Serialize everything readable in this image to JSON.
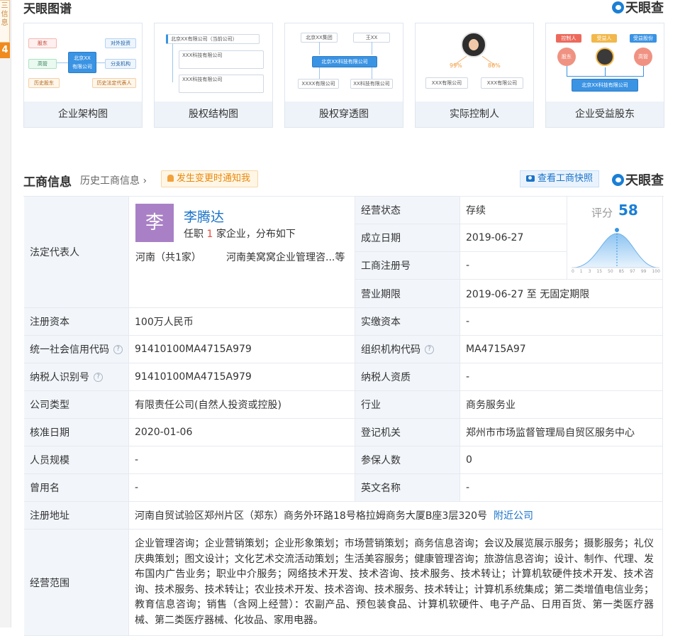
{
  "rail": {
    "tab_text": "三\n信\n息",
    "badge": "4"
  },
  "graph": {
    "title": "天眼图谱",
    "brand": "天眼查",
    "cards": [
      {
        "label": "企业架构图",
        "nodes": {
          "shareholder": "股东",
          "executive": "高管",
          "history_shareholder": "历史股东",
          "investment": "对外投资",
          "branch": "分支机构",
          "history_legal": "历史法定代表人",
          "center": "北京XX\n有限公司"
        }
      },
      {
        "label": "股权结构图",
        "nodes": {
          "top": "北京XX有限公司（当前公司）",
          "a": "XXX科技有限公司",
          "b": "XXX科技有限公司"
        }
      },
      {
        "label": "股权穿透图",
        "nodes": {
          "a": "北京XX集团",
          "b": "王XX",
          "center": "北京XX科技有限公司",
          "c": "XXXX有限公司",
          "d": "XX科技有限公司"
        }
      },
      {
        "label": "实际控制人",
        "nodes": {
          "p1": "99%",
          "p2": "86%",
          "a": "XXX有限公司",
          "b": "XXX有限公司"
        }
      },
      {
        "label": "企业受益股东",
        "nodes": {
          "t1": "控制人",
          "t2": "受益人",
          "t3": "受益股份",
          "c1": "股东",
          "c3": "高管",
          "main": "北京XX科技有限公司"
        }
      }
    ]
  },
  "biz": {
    "title": "工商信息",
    "history_link": "历史工商信息",
    "notify_label": "发生变更时通知我",
    "snapshot_label": "查看工商快照",
    "brand": "天眼查",
    "legal": {
      "key": "法定代表人",
      "avatar_char": "李",
      "name": "李腾达",
      "tenure_prefix": "任职",
      "tenure_count": "1",
      "tenure_suffix": "家企业，分布如下",
      "region": "河南（共1家）",
      "company": "河南美窝窝企业管理咨...等"
    },
    "score": {
      "label": "评分",
      "value": "58",
      "ticks": [
        "0",
        "1",
        "3",
        "15",
        "50",
        "85",
        "97",
        "99",
        "100"
      ]
    },
    "top_rows": [
      {
        "key": "经营状态",
        "value": "存续"
      },
      {
        "key": "成立日期",
        "value": "2019-06-27"
      },
      {
        "key": "工商注册号",
        "value": "-"
      },
      {
        "key": "营业期限",
        "value": "2019-06-27  至 无固定期限"
      }
    ],
    "rows": [
      {
        "k1": "注册资本",
        "v1": "100万人民币",
        "k2": "实缴资本",
        "v2": "-"
      },
      {
        "k1": "统一社会信用代码",
        "v1": "91410100MA4715A979",
        "k2": "组织机构代码",
        "v2": "MA4715A97"
      },
      {
        "k1": "纳税人识别号",
        "v1": "91410100MA4715A979",
        "k2": "纳税人资质",
        "v2": "-"
      },
      {
        "k1": "公司类型",
        "v1": "有限责任公司(自然人投资或控股)",
        "k2": "行业",
        "v2": "商务服务业"
      },
      {
        "k1": "核准日期",
        "v1": "2020-01-06",
        "k2": "登记机关",
        "v2": "郑州市市场监督管理局自贸区服务中心"
      },
      {
        "k1": "人员规模",
        "v1": "-",
        "k2": "参保人数",
        "v2": "0"
      },
      {
        "k1": "曾用名",
        "v1": "-",
        "k2": "英文名称",
        "v2": "-"
      }
    ],
    "address": {
      "key": "注册地址",
      "value": "河南自贸试验区郑州片区（郑东）商务外环路18号格拉姆商务大厦B座3层320号",
      "link": "附近公司"
    },
    "scope": {
      "key": "经营范围",
      "value": "企业管理咨询；企业营销策划；企业形象策划；市场营销策划；商务信息咨询；会议及展览展示服务；摄影服务；礼仪庆典策划；图文设计；文化艺术交流活动策划；生活美容服务；健康管理咨询；旅游信息咨询；设计、制作、代理、发布国内广告业务；职业中介服务；网络技术开发、技术咨询、技术服务、技术转让；计算机软硬件技术开发、技术咨询、技术服务、技术转让；农业技术开发、技术咨询、技术服务、技术转让；计算机系统集成；第二类增值电信业务；教育信息咨询；销售（含网上经营）：农副产品、预包装食品、计算机软硬件、电子产品、日用百货、第一类医疗器械、第二类医疗器械、化妆品、家用电器。"
    }
  }
}
